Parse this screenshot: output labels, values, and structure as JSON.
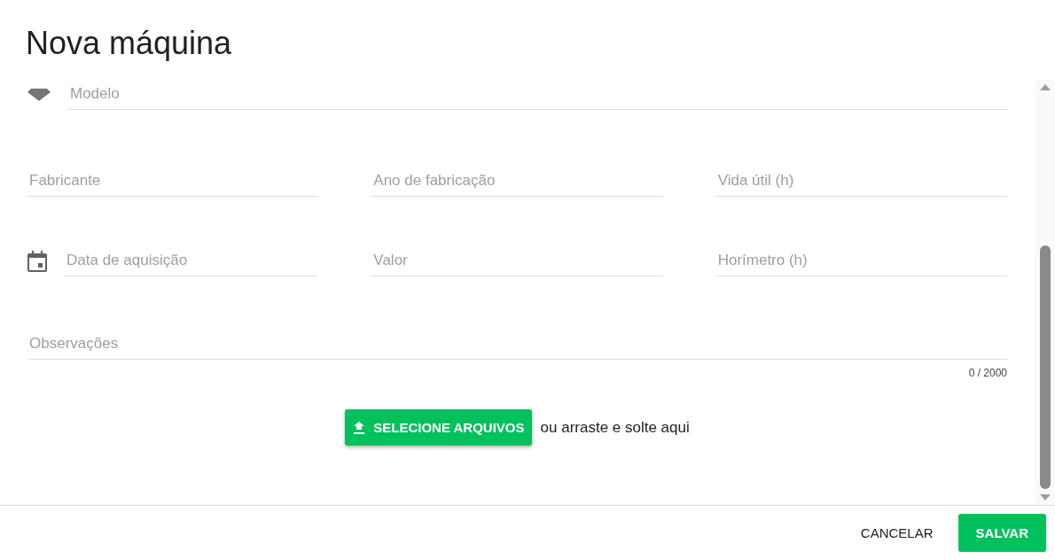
{
  "dialog": {
    "title": "Nova máquina"
  },
  "rows": [
    [
      {
        "placeholder": "Modelo",
        "kind": "tag"
      }
    ],
    [
      {
        "placeholder": "Fabricante"
      },
      {
        "placeholder": "Ano de fabricação"
      },
      {
        "placeholder": "Vida útil (h)"
      }
    ],
    [
      {
        "placeholder": "Data de aquisição",
        "kind": "calendar"
      },
      {
        "placeholder": "Valor"
      },
      {
        "placeholder": "Horímetro (h)"
      }
    ],
    [
      {
        "placeholder": "Observações",
        "counter": "0 / 2000"
      }
    ]
  ],
  "upload": {
    "button": "SELECIONE ARQUIVOS",
    "hint": "ou arraste e solte aqui"
  },
  "footer": {
    "cancel": "CANCELAR",
    "save": "SALVAR"
  }
}
